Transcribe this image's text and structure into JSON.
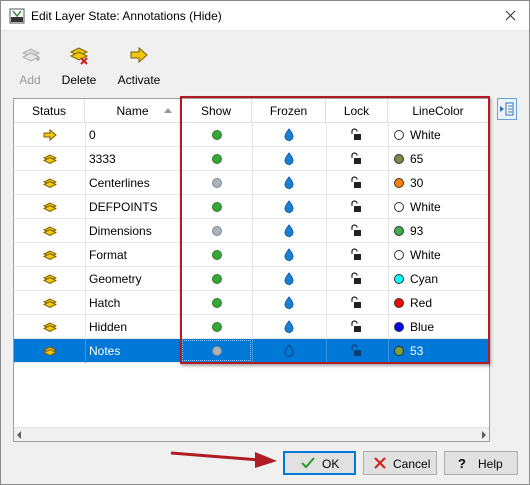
{
  "window": {
    "title": "Edit Layer State: Annotations (Hide)"
  },
  "toolbar": {
    "add_label": "Add",
    "delete_label": "Delete",
    "activate_label": "Activate"
  },
  "grid": {
    "columns": [
      "Status",
      "Name",
      "Show",
      "Frozen",
      "Lock",
      "LineColor"
    ],
    "rows": [
      {
        "name": "0",
        "status": "current-arrow",
        "show": "on",
        "color_name": "White",
        "color_hex": "#ffffff"
      },
      {
        "name": "3333",
        "status": "layer",
        "show": "on",
        "color_name": "65",
        "color_hex": "#7a8a45"
      },
      {
        "name": "Centerlines",
        "status": "layer",
        "show": "off",
        "color_name": "30",
        "color_hex": "#ff7f00"
      },
      {
        "name": "DEFPOINTS",
        "status": "layer",
        "show": "on",
        "color_name": "White",
        "color_hex": "#ffffff"
      },
      {
        "name": "Dimensions",
        "status": "layer",
        "show": "off",
        "color_name": "93",
        "color_hex": "#3fae49"
      },
      {
        "name": "Format",
        "status": "layer",
        "show": "on",
        "color_name": "White",
        "color_hex": "#ffffff"
      },
      {
        "name": "Geometry",
        "status": "layer",
        "show": "on",
        "color_name": "Cyan",
        "color_hex": "#00ffff"
      },
      {
        "name": "Hatch",
        "status": "layer",
        "show": "on",
        "color_name": "Red",
        "color_hex": "#ff0000"
      },
      {
        "name": "Hidden",
        "status": "layer",
        "show": "on",
        "color_name": "Blue",
        "color_hex": "#0000ff"
      },
      {
        "name": "Notes",
        "status": "layer",
        "show": "off",
        "color_name": "53",
        "color_hex": "#7f9f3f",
        "selected": true
      }
    ]
  },
  "buttons": {
    "ok_label": "OK",
    "cancel_label": "Cancel",
    "help_label": "Help"
  },
  "colors": {
    "selection": "#0078d7",
    "show_on": "#3aa63a",
    "show_off": "#a9b4bd",
    "frozen": "#1a7fd6",
    "highlight_box": "#b11c24"
  }
}
